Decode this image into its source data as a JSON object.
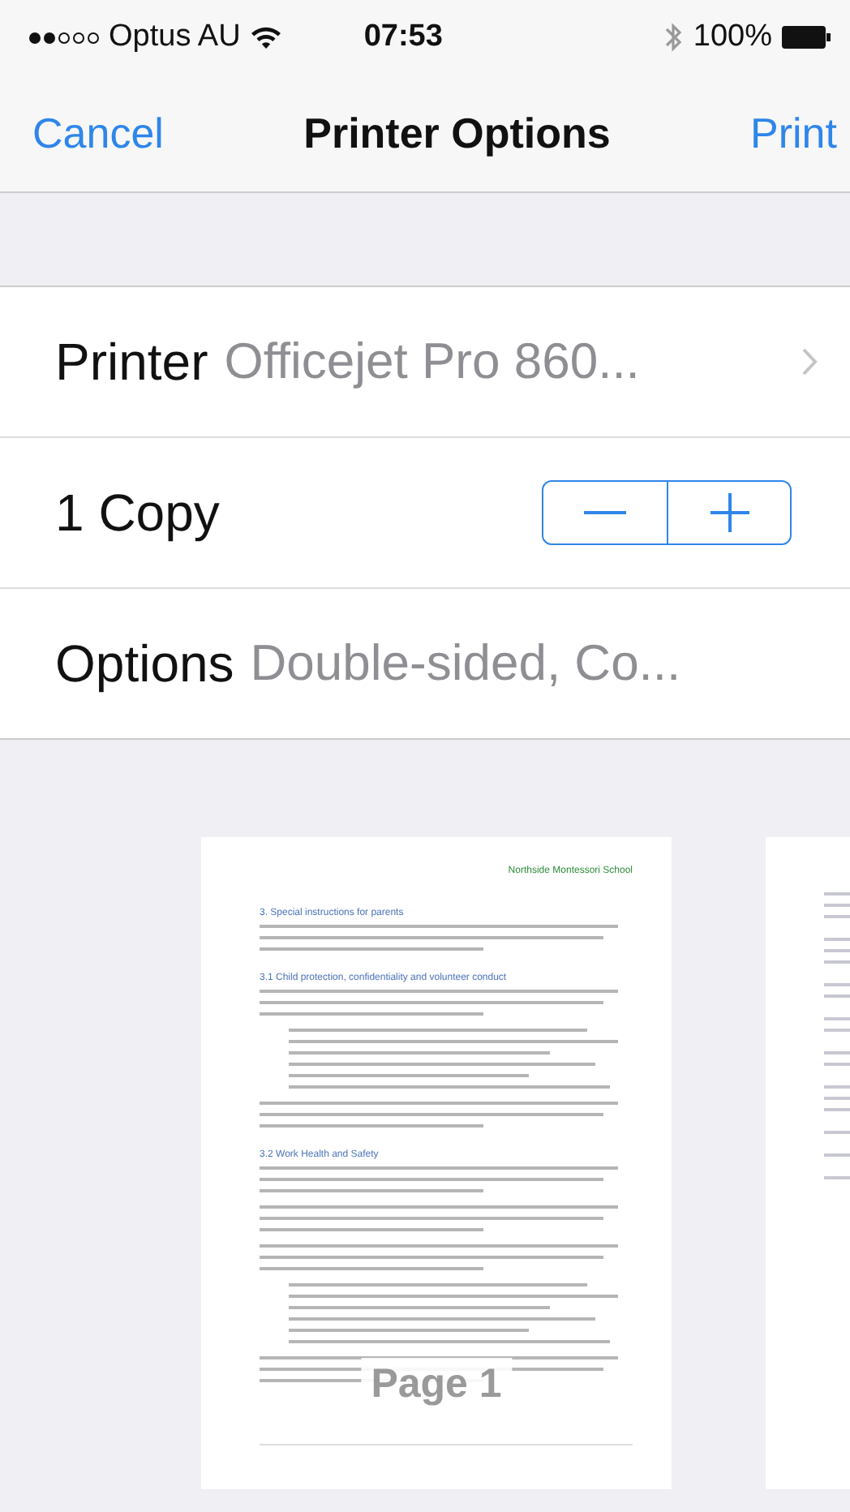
{
  "status_bar": {
    "carrier": "Optus AU",
    "time": "07:53",
    "battery": "100%"
  },
  "nav": {
    "cancel": "Cancel",
    "title": "Printer Options",
    "print": "Print"
  },
  "rows": [
    {
      "kind": "link",
      "label": "Printer",
      "value": "Officejet Pro 860..."
    },
    {
      "kind": "stepper",
      "label": "1 Copy"
    },
    {
      "kind": "detail",
      "label": "Options",
      "value": "Double-sided, Co..."
    }
  ],
  "pages": [
    {
      "kind": "full",
      "header": "Northside Montessori School",
      "sections": [
        {
          "heading": "3. Special instructions for parents",
          "paragraphs": [
            {
              "kind": "lines"
            }
          ]
        },
        {
          "heading": "3.1 Child protection, confidentiality and volunteer conduct",
          "paragraphs": [
            {
              "kind": "lines"
            },
            {
              "kind": "bullets"
            },
            {
              "kind": "lines"
            }
          ]
        },
        {
          "heading": "3.2 Work Health and Safety",
          "paragraphs": [
            {
              "kind": "lines"
            },
            {
              "kind": "lines"
            },
            {
              "kind": "lines"
            },
            {
              "kind": "bullets"
            },
            {
              "kind": "lines"
            }
          ]
        }
      ],
      "page_label": "Page 1"
    },
    {
      "kind": "partial"
    }
  ]
}
